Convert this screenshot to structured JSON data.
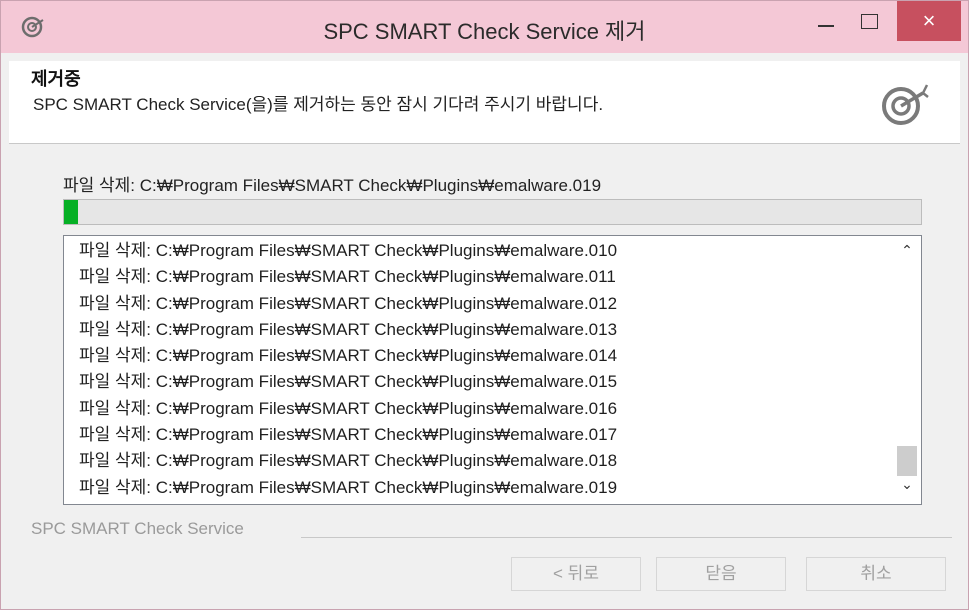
{
  "window": {
    "title": "SPC SMART Check Service 제거",
    "close_glyph": "×"
  },
  "header": {
    "title": "제거중",
    "subtitle": "SPC SMART Check Service(을)를 제거하는 동안 잠시 기다려 주시기 바랍니다."
  },
  "status": {
    "current": "파일 삭제: C:₩Program Files₩SMART Check₩Plugins₩emalware.019",
    "progress_percent": 1.6,
    "progress_color": "#06b025"
  },
  "log": {
    "lines": [
      "파일 삭제: C:₩Program Files₩SMART Check₩Plugins₩emalware.010",
      "파일 삭제: C:₩Program Files₩SMART Check₩Plugins₩emalware.011",
      "파일 삭제: C:₩Program Files₩SMART Check₩Plugins₩emalware.012",
      "파일 삭제: C:₩Program Files₩SMART Check₩Plugins₩emalware.013",
      "파일 삭제: C:₩Program Files₩SMART Check₩Plugins₩emalware.014",
      "파일 삭제: C:₩Program Files₩SMART Check₩Plugins₩emalware.015",
      "파일 삭제: C:₩Program Files₩SMART Check₩Plugins₩emalware.016",
      "파일 삭제: C:₩Program Files₩SMART Check₩Plugins₩emalware.017",
      "파일 삭제: C:₩Program Files₩SMART Check₩Plugins₩emalware.018",
      "파일 삭제: C:₩Program Files₩SMART Check₩Plugins₩emalware.019"
    ],
    "scroll_up_glyph": "⌃",
    "scroll_down_glyph": "⌄"
  },
  "footer": {
    "brand": "SPC SMART Check Service",
    "back_label": "< 뒤로",
    "close_label": "닫음",
    "cancel_label": "취소"
  },
  "icons": {
    "app": "spc-logo-icon",
    "minimize": "minimize-icon",
    "maximize": "maximize-icon",
    "close": "close-icon"
  },
  "colors": {
    "titlebar": "#f4c8d6",
    "close_button": "#c7505f"
  }
}
